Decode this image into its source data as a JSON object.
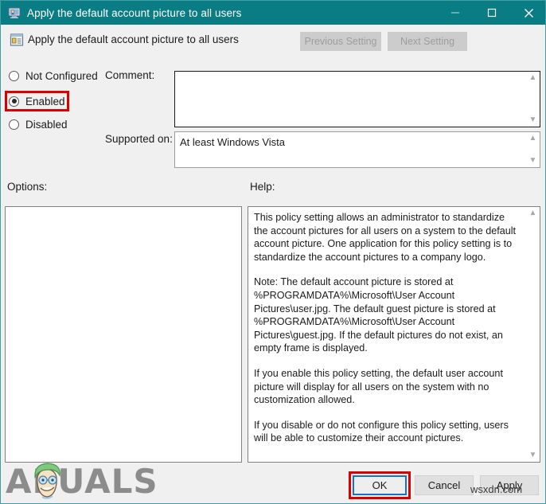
{
  "window": {
    "title": "Apply the default account picture to all users",
    "icon": "user-account-picture-icon",
    "controls": {
      "minimize": "minimize-icon",
      "maximize": "maximize-icon",
      "close": "close-icon"
    }
  },
  "header": {
    "icon": "group-policy-setting-icon",
    "title": "Apply the default account picture to all users",
    "previous_setting_label": "Previous Setting",
    "next_setting_label": "Next Setting",
    "previous_setting_enabled": false,
    "next_setting_enabled": false
  },
  "state_options": {
    "selected": "Enabled",
    "items": [
      {
        "label": "Not Configured",
        "checked": false
      },
      {
        "label": "Enabled",
        "checked": true
      },
      {
        "label": "Disabled",
        "checked": false
      }
    ]
  },
  "comment": {
    "label": "Comment:",
    "value": "",
    "placeholder": ""
  },
  "supported_on": {
    "label": "Supported on:",
    "value": "At least Windows Vista"
  },
  "options": {
    "label": "Options:",
    "value": ""
  },
  "help": {
    "label": "Help:",
    "paragraphs": [
      "This policy setting allows an administrator to standardize the account pictures for all users on a system to the default account picture. One application for this policy setting is to standardize the account pictures to a company logo.",
      "Note: The default account picture is stored at %PROGRAMDATA%\\Microsoft\\User Account Pictures\\user.jpg. The default guest picture is stored at %PROGRAMDATA%\\Microsoft\\User Account Pictures\\guest.jpg. If the default pictures do not exist, an empty frame is displayed.",
      "If you enable this policy setting, the default user account picture will display for all users on the system with no customization allowed.",
      "If you disable or do not configure this policy setting, users will be able to customize their account pictures."
    ]
  },
  "footer": {
    "ok_label": "OK",
    "cancel_label": "Cancel",
    "apply_label": "Apply"
  },
  "watermarks": {
    "site": "wsxdn.com",
    "brand": "APUALS"
  },
  "annotations": {
    "color": "#d80000",
    "focus_color": "#1274c8",
    "targets": [
      "Enabled",
      "OK"
    ]
  },
  "colors": {
    "titlebar": "#0a7c83",
    "dialog_background": "#f0f0f0",
    "panel_background": "#ffffff",
    "border": "#3f9ea5"
  }
}
